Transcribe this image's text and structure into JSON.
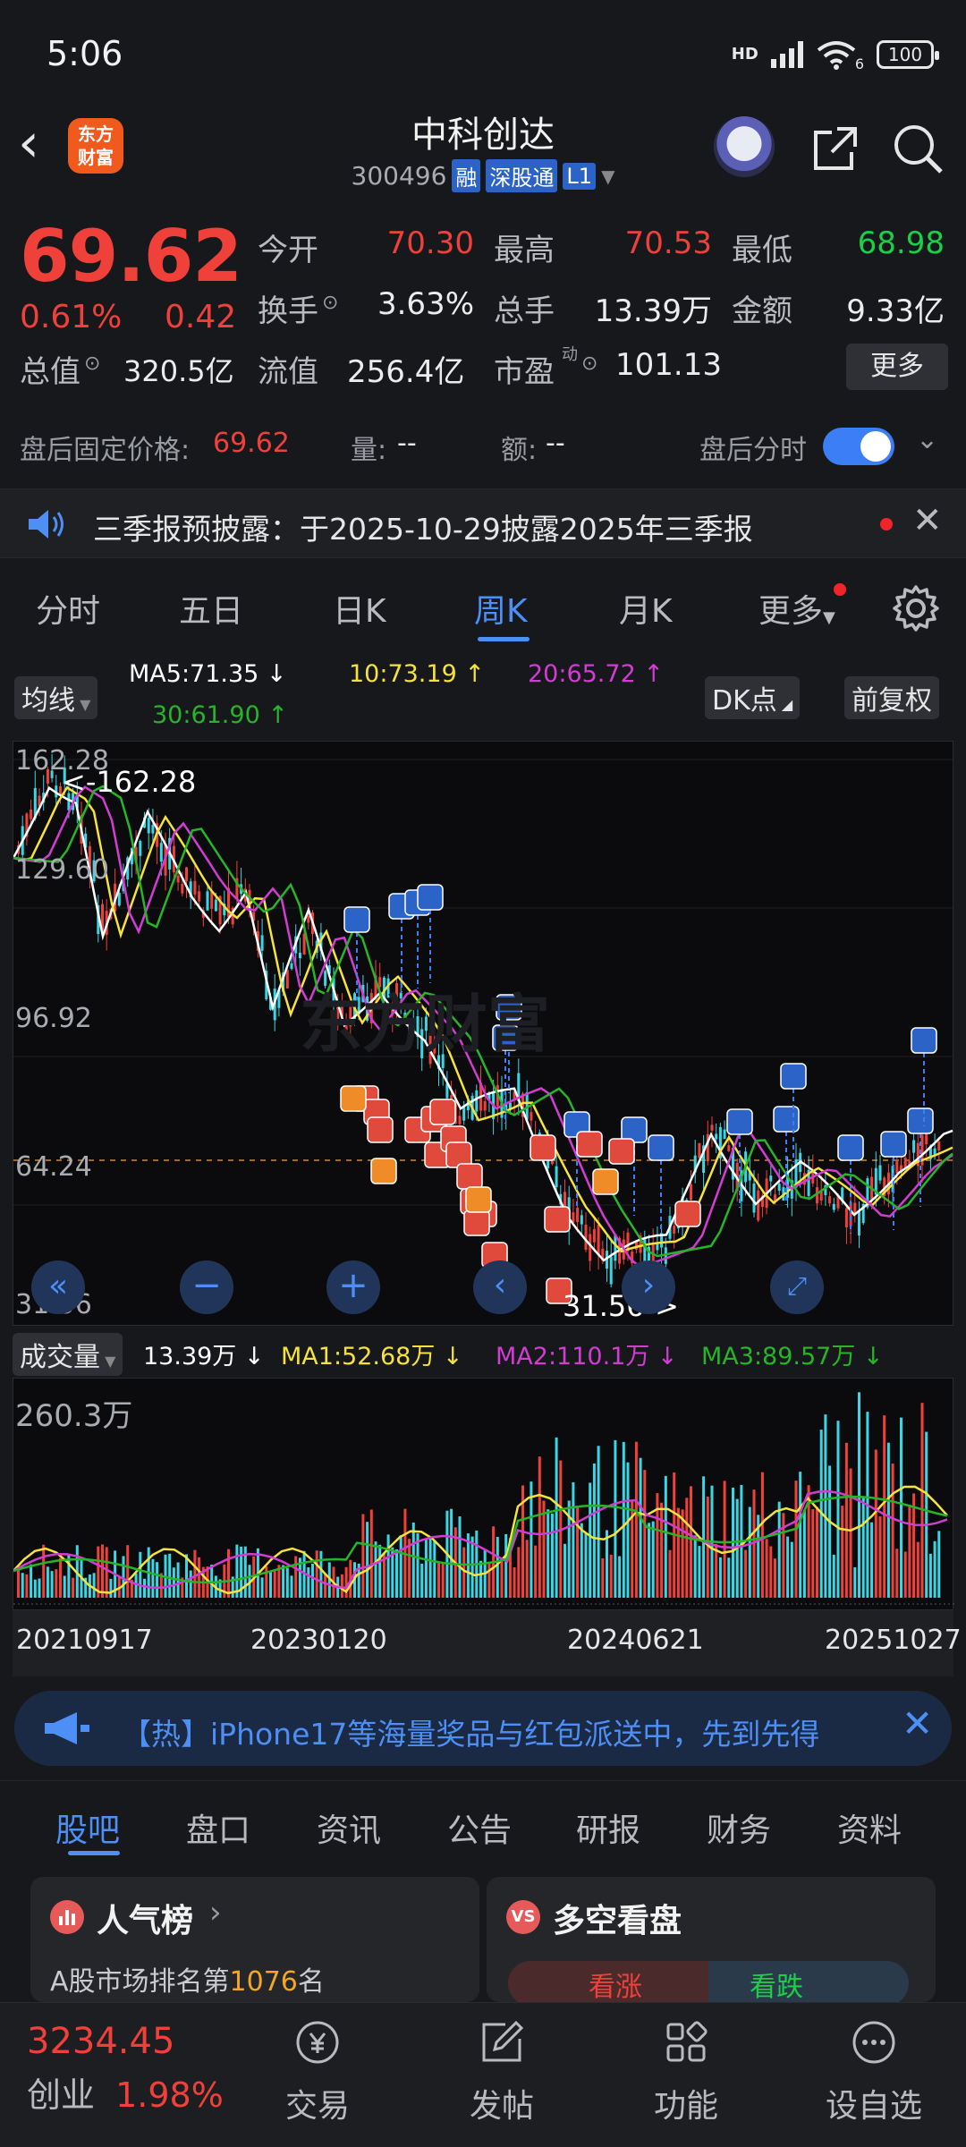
{
  "status_bar": {
    "time": "5:06",
    "network": "HD",
    "wifi_count": "6",
    "battery": "100"
  },
  "header": {
    "back_glyph": "‹",
    "logo_text_1": "东方",
    "logo_text_2": "财富",
    "stock_name": "中科创达",
    "stock_code": "300496",
    "tags": [
      "融",
      "深股通",
      "L1"
    ]
  },
  "quote": {
    "price": "69.62",
    "pct_change": "0.61%",
    "abs_change": "0.42",
    "open_label": "今开",
    "open": "70.30",
    "high_label": "最高",
    "high": "70.53",
    "low_label": "最低",
    "low": "68.98",
    "turnover_label": "换手",
    "turnover": "3.63%",
    "volume_label": "总手",
    "volume": "13.39万",
    "amount_label": "金额",
    "amount": "9.33亿",
    "mktcap_label": "总值",
    "mktcap": "320.5亿",
    "float_label": "流值",
    "float_cap": "256.4亿",
    "pe_label": "市盈",
    "pe_sup": "动",
    "pe": "101.13",
    "more_label": "更多"
  },
  "after_hours": {
    "price_label": "盘后固定价格:",
    "price": "69.62",
    "vol_label": "量:",
    "vol": "--",
    "amt_label": "额:",
    "amt": "--",
    "intraday_label": "盘后分时"
  },
  "notice": {
    "text": "三季报预披露：于2025-10-29披露2025年三季报",
    "close": "✕"
  },
  "chart_tabs": [
    "分时",
    "五日",
    "日K",
    "周K",
    "月K",
    "更多"
  ],
  "ma_legend": {
    "selector": "均线",
    "ma5": "MA5:71.35 ↓",
    "ma10": "10:73.19 ↑",
    "ma20": "20:65.72 ↑",
    "ma30": "30:61.90 ↑",
    "dk_button": "DK点",
    "adjust_button": "前复权",
    "colors": {
      "ma5": "#ffffff",
      "ma10": "#f5e23c",
      "ma20": "#d23cd2",
      "ma30": "#28b428"
    }
  },
  "kline": {
    "y_labels": [
      "162.28",
      "129.60",
      "96.92",
      "64.24",
      "31.56"
    ],
    "max_annotation": "<-162.28",
    "min_annotation": "31.56->",
    "watermark": "东方财富"
  },
  "volume_legend": {
    "selector": "成交量",
    "value": "13.39万 ↓",
    "ma1": "MA1:52.68万 ↓",
    "ma2": "MA2:110.1万 ↓",
    "ma3": "MA3:89.57万 ↓",
    "y_max": "260.3万"
  },
  "x_labels": [
    "20210917",
    "20230120",
    "20240621",
    "20251027"
  ],
  "banner": {
    "text": "【热】iPhone17等海量奖品与红包派送中，先到先得",
    "close": "✕"
  },
  "section_tabs": [
    "股吧",
    "盘口",
    "资讯",
    "公告",
    "研报",
    "财务",
    "资料"
  ],
  "cards": {
    "left_title": "人气榜",
    "left_sub_prefix": "A股市场排名第",
    "left_rank": "1076",
    "left_sub_suffix": "名",
    "right_title": "多空看盘",
    "bull": "看涨",
    "bear": "看跌"
  },
  "bottom_nav": {
    "index_value": "3234.45",
    "index_name": "创业",
    "index_pct": "1.98%",
    "items": [
      "交易",
      "发帖",
      "功能",
      "设自选"
    ]
  }
}
